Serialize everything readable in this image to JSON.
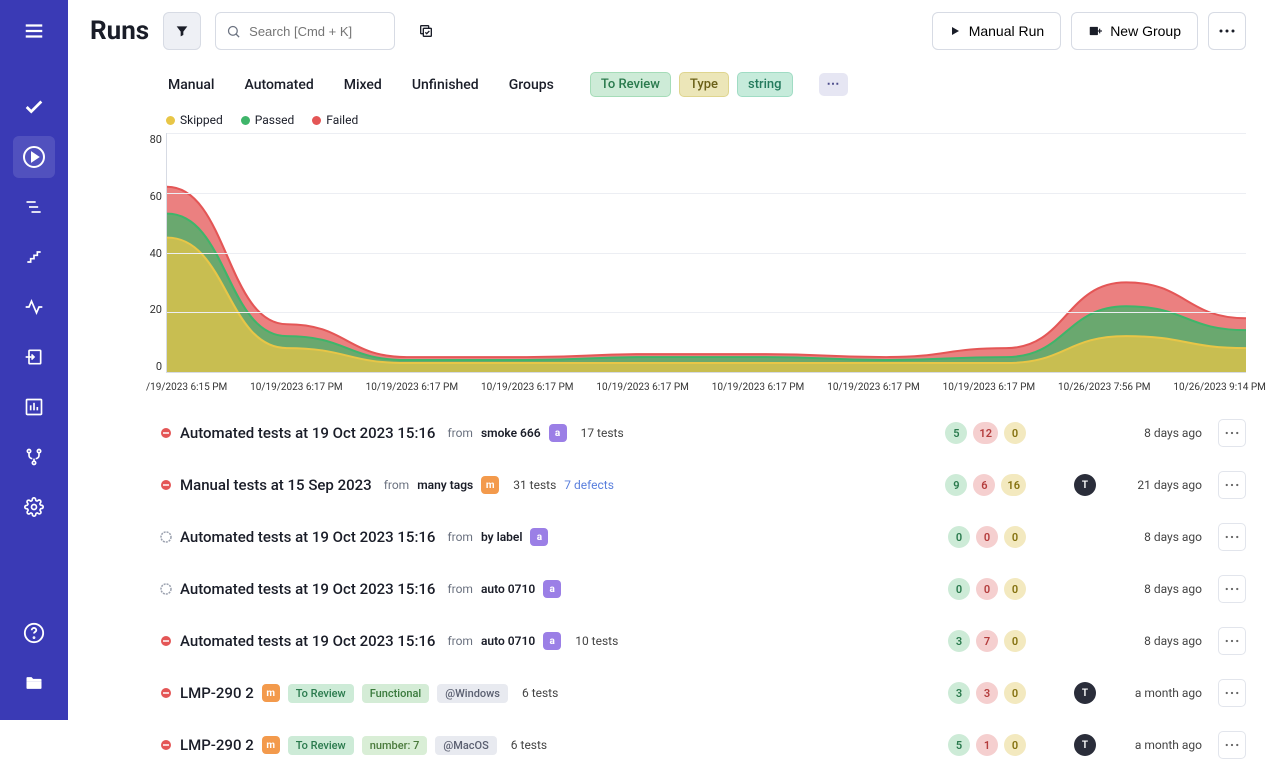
{
  "header": {
    "title": "Runs",
    "search_placeholder": "Search [Cmd + K]",
    "manual_run_label": "Manual Run",
    "new_group_label": "New Group"
  },
  "tabs": [
    "Manual",
    "Automated",
    "Mixed",
    "Unfinished",
    "Groups"
  ],
  "filter_pills": [
    {
      "label": "To Review",
      "cls": "pill-green"
    },
    {
      "label": "Type",
      "cls": "pill-yellow"
    },
    {
      "label": "string",
      "cls": "pill-aqua"
    }
  ],
  "legend": [
    {
      "label": "Skipped",
      "color": "dot-yellow"
    },
    {
      "label": "Passed",
      "color": "dot-green"
    },
    {
      "label": "Failed",
      "color": "dot-red"
    }
  ],
  "chart_data": {
    "type": "area",
    "ylim": [
      0,
      80
    ],
    "yticks": [
      "80",
      "60",
      "40",
      "20",
      "0"
    ],
    "x_labels": [
      "/19/2023 6:15 PM",
      "10/19/2023 6:17 PM",
      "10/19/2023 6:17 PM",
      "10/19/2023 6:17 PM",
      "10/19/2023 6:17 PM",
      "10/19/2023 6:17 PM",
      "10/19/2023 6:17 PM",
      "10/19/2023 6:17 PM",
      "10/26/2023 7:56 PM",
      "10/26/2023 9:14 PM"
    ],
    "series": [
      {
        "name": "Skipped",
        "color": "#e8c647",
        "values": [
          45,
          8,
          3,
          3,
          3,
          3,
          3,
          3,
          12,
          8
        ]
      },
      {
        "name": "Passed",
        "color": "#3fb56a",
        "values": [
          53,
          12,
          4,
          4,
          5,
          5,
          4,
          5,
          22,
          14
        ]
      },
      {
        "name": "Failed",
        "color": "#e45656",
        "values": [
          62,
          16,
          5,
          5,
          6,
          6,
          5,
          8,
          30,
          18
        ]
      }
    ]
  },
  "runs": [
    {
      "status": "fail",
      "title": "Automated tests at 19 Oct 2023 15:16",
      "from": "smoke 666",
      "type": "a",
      "tests": "17 tests",
      "defects": "",
      "counts": [
        "5",
        "12",
        "0"
      ],
      "avatar": "",
      "time": "8 days ago"
    },
    {
      "status": "fail",
      "title": "Manual tests at 15 Sep 2023",
      "from": "many tags",
      "type": "m",
      "tests": "31 tests",
      "defects": "7 defects",
      "counts": [
        "9",
        "6",
        "16"
      ],
      "avatar": "T",
      "time": "21 days ago"
    },
    {
      "status": "none",
      "title": "Automated tests at 19 Oct 2023 15:16",
      "from": "by label",
      "type": "a",
      "tests": "",
      "defects": "",
      "counts": [
        "0",
        "0",
        "0"
      ],
      "avatar": "",
      "time": "8 days ago"
    },
    {
      "status": "none",
      "title": "Automated tests at 19 Oct 2023 15:16",
      "from": "auto 0710",
      "type": "a",
      "tests": "",
      "defects": "",
      "counts": [
        "0",
        "0",
        "0"
      ],
      "avatar": "",
      "time": "8 days ago"
    },
    {
      "status": "fail",
      "title": "Automated tests at 19 Oct 2023 15:16",
      "from": "auto 0710",
      "type": "a",
      "tests": "10 tests",
      "defects": "",
      "counts": [
        "3",
        "7",
        "0"
      ],
      "avatar": "",
      "time": "8 days ago"
    },
    {
      "status": "fail",
      "title": "LMP-290 2",
      "from": "",
      "type": "m",
      "tests": "6 tests",
      "defects": "",
      "tags": [
        {
          "t": "To Review",
          "c": "tp-review"
        },
        {
          "t": "Functional",
          "c": "tp-func"
        },
        {
          "t": "@Windows",
          "c": "tp-grey"
        }
      ],
      "counts": [
        "3",
        "3",
        "0"
      ],
      "avatar": "T",
      "time": "a month ago"
    },
    {
      "status": "fail",
      "title": "LMP-290 2",
      "from": "",
      "type": "m",
      "tests": "6 tests",
      "defects": "",
      "tags": [
        {
          "t": "To Review",
          "c": "tp-review"
        },
        {
          "t": "number: 7",
          "c": "tp-num"
        },
        {
          "t": "@MacOS",
          "c": "tp-grey"
        }
      ],
      "counts": [
        "5",
        "1",
        "0"
      ],
      "avatar": "T",
      "time": "a month ago"
    }
  ]
}
